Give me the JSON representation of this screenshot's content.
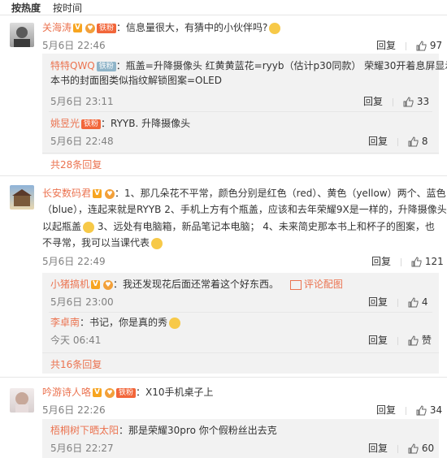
{
  "sort": {
    "hot": "按热度",
    "time": "按时间"
  },
  "actions": {
    "reply": "回复"
  },
  "comments": [
    {
      "user": "关海涛",
      "fan": "铁粉",
      "text": "：信息量很大，有猜中的小伙伴吗?",
      "time": "5月6日 22:46",
      "likes": "97",
      "replies": [
        {
          "user": "特特QWQ",
          "fan": "铁粉",
          "text1": "：瓶盖=升降摄像头   红黄黄蓝花=ryyb（估计p30同款）  荣耀30开着息屏显示那",
          "text2": "本书的封面图类似指纹解锁图案=OLED",
          "time": "5月6日 23:11",
          "likes": "33"
        },
        {
          "user": "姚昱光",
          "fan": "铁粉",
          "text": "：RYYB. 升降摄像头",
          "time": "5月6日 22:48",
          "likes": "8"
        }
      ],
      "more": "共28条回复"
    },
    {
      "user": "长安数码君",
      "text1": "：1、那几朵花不平常，颜色分别是红色（red）、黄色（yellow）两个、蓝色",
      "text2": "（blue），连起来就是RYYB      2、手机上方有个瓶盖，应该和去年荣耀9X是一样的，升降摄像头可",
      "text3": "以起瓶盖",
      "text3b": "     3、远处有电脑箱，新品笔记本电脑；    4、未来简史那本书上和杯子的图案，也",
      "text4": "不寻常，我可以当课代表",
      "time": "5月6日 22:49",
      "likes": "121",
      "replies": [
        {
          "user": "小猪搞机",
          "text": "：我还发现花后面还常着这个好东西。",
          "link": "评论配图",
          "time": "5月6日 23:00",
          "likes": "4"
        },
        {
          "user": "李卓南",
          "text": "：书记，你是真的秀",
          "time": "今天 06:41",
          "likes": "赞"
        }
      ],
      "more": "共16条回复"
    },
    {
      "user": "吟游诗人咯",
      "fan": "铁粉",
      "text": "：X10手机桌子上",
      "time": "5月6日 22:26",
      "likes": "34",
      "replies": [
        {
          "user": "梧桐树下晒太阳",
          "text": "：那是荣耀30pro 你个假粉丝出去克",
          "time": "5月6日 22:27",
          "likes": "60"
        }
      ]
    }
  ]
}
